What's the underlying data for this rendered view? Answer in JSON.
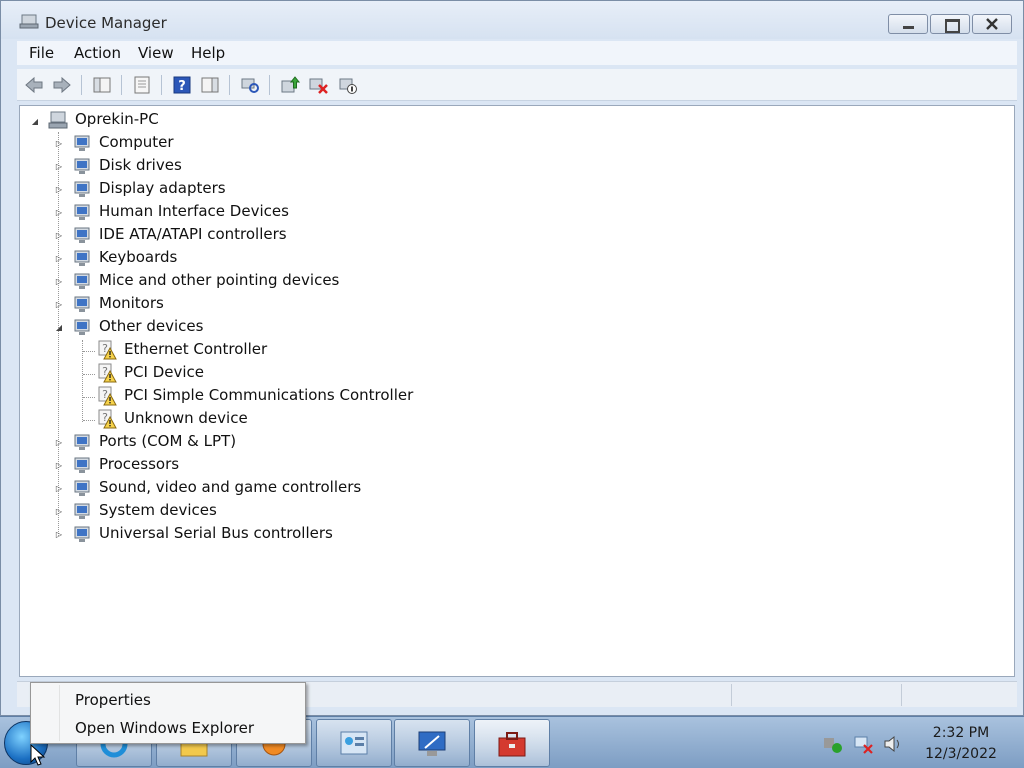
{
  "window": {
    "title": "Device Manager",
    "menu": [
      "File",
      "Action",
      "View",
      "Help"
    ],
    "toolbar_icons": [
      "back-icon",
      "forward-icon",
      "show-hide-console-tree-icon",
      "properties-icon",
      "help-icon",
      "show-hide-action-pane-icon",
      "scan-hardware-icon",
      "update-driver-icon",
      "uninstall-icon",
      "disable-icon"
    ]
  },
  "tree": {
    "root": "Oprekin-PC",
    "categories": [
      {
        "label": "Computer",
        "icon": "computer-icon"
      },
      {
        "label": "Disk drives",
        "icon": "disk-drive-icon"
      },
      {
        "label": "Display adapters",
        "icon": "display-adapter-icon"
      },
      {
        "label": "Human Interface Devices",
        "icon": "hid-icon"
      },
      {
        "label": "IDE ATA/ATAPI controllers",
        "icon": "ide-controller-icon"
      },
      {
        "label": "Keyboards",
        "icon": "keyboard-icon"
      },
      {
        "label": "Mice and other pointing devices",
        "icon": "mouse-icon"
      },
      {
        "label": "Monitors",
        "icon": "monitor-icon"
      },
      {
        "label": "Other devices",
        "icon": "unknown-device-icon",
        "expanded": true,
        "children": [
          {
            "label": "Ethernet Controller",
            "icon": "warning-device-icon"
          },
          {
            "label": "PCI Device",
            "icon": "warning-device-icon"
          },
          {
            "label": "PCI Simple Communications Controller",
            "icon": "warning-device-icon"
          },
          {
            "label": "Unknown device",
            "icon": "warning-device-icon"
          }
        ]
      },
      {
        "label": "Ports (COM & LPT)",
        "icon": "port-icon"
      },
      {
        "label": "Processors",
        "icon": "processor-icon"
      },
      {
        "label": "Sound, video and game controllers",
        "icon": "sound-icon"
      },
      {
        "label": "System devices",
        "icon": "system-device-icon"
      },
      {
        "label": "Universal Serial Bus controllers",
        "icon": "usb-icon"
      }
    ]
  },
  "context_menu": {
    "items": [
      "Properties",
      "Open Windows Explorer"
    ]
  },
  "taskbar": {
    "time": "2:32 PM",
    "date": "12/3/2022"
  }
}
